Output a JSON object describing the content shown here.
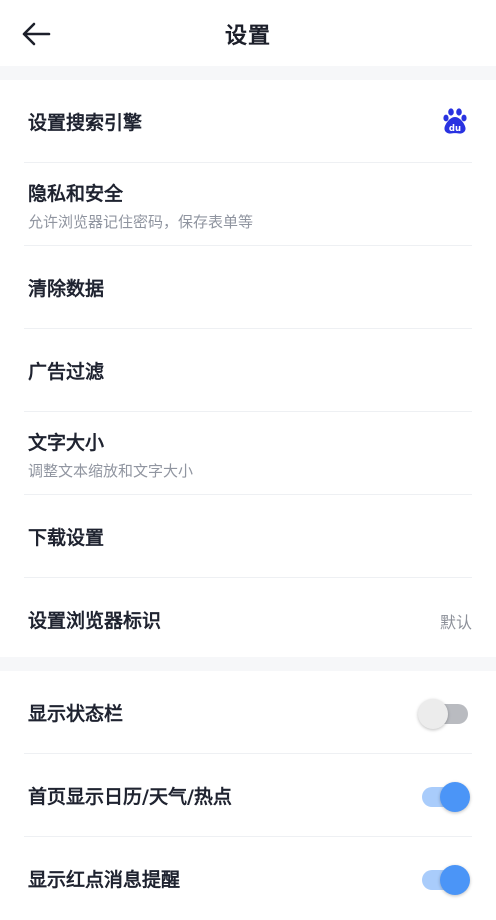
{
  "header": {
    "title": "设置"
  },
  "settings": {
    "items": [
      {
        "label": "设置搜索引擎",
        "subtitle": "",
        "value": "",
        "icon": "baidu-logo-icon"
      },
      {
        "label": "隐私和安全",
        "subtitle": "允许浏览器记住密码，保存表单等",
        "value": ""
      },
      {
        "label": "清除数据",
        "subtitle": "",
        "value": ""
      },
      {
        "label": "广告过滤",
        "subtitle": "",
        "value": ""
      },
      {
        "label": "文字大小",
        "subtitle": "调整文本缩放和文字大小",
        "value": ""
      },
      {
        "label": "下载设置",
        "subtitle": "",
        "value": ""
      },
      {
        "label": "设置浏览器标识",
        "subtitle": "",
        "value": "默认"
      }
    ]
  },
  "display": {
    "items": [
      {
        "label": "显示状态栏",
        "toggle": "off"
      },
      {
        "label": "首页显示日历/天气/热点",
        "toggle": "on"
      },
      {
        "label": "显示红点消息提醒",
        "toggle": "on"
      }
    ]
  },
  "colors": {
    "accent": "#4b95f7",
    "baidu_blue": "#2932e1",
    "section_background": "#f6f7f9"
  }
}
